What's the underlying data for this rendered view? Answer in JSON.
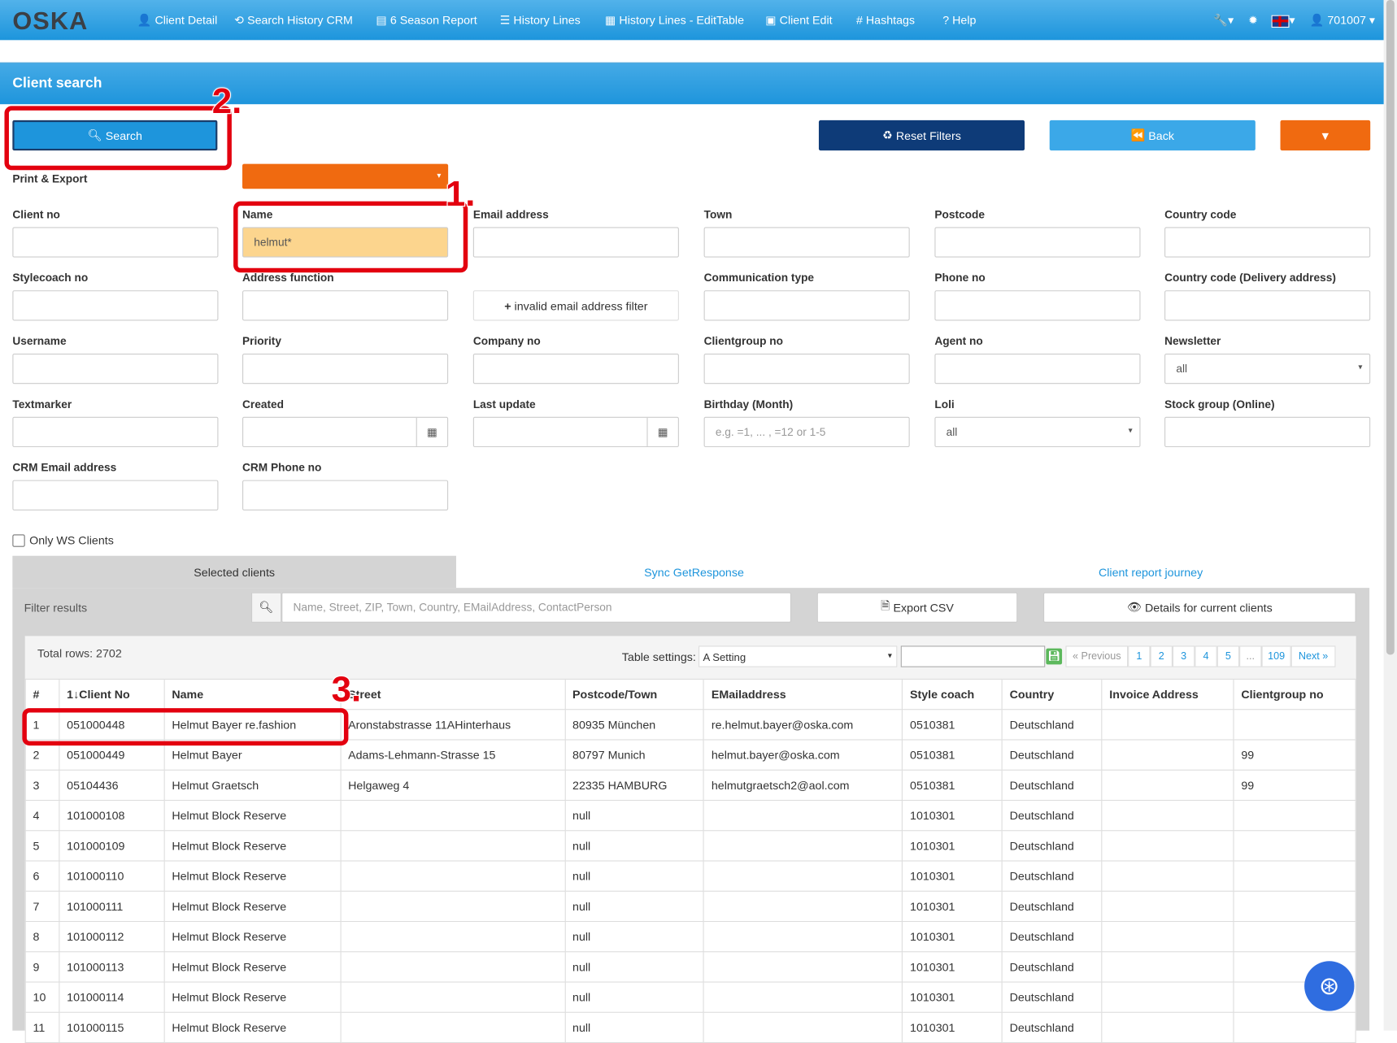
{
  "nav": {
    "logo": "OSKA",
    "items": [
      {
        "icon": "user-icon",
        "glyph": "👤",
        "label": "Client Detail"
      },
      {
        "icon": "history-icon",
        "glyph": "⟲",
        "label": "Search History CRM"
      },
      {
        "icon": "list-alt-icon",
        "glyph": "▤",
        "label": "6 Season Report"
      },
      {
        "icon": "list-icon",
        "glyph": "☰",
        "label": "History Lines"
      },
      {
        "icon": "table-icon",
        "glyph": "▦",
        "label": "History Lines - EditTable"
      },
      {
        "icon": "contact-icon",
        "glyph": "▣",
        "label": "Client Edit"
      },
      {
        "icon": "hashtag-icon",
        "glyph": "#",
        "label": "Hashtags"
      },
      {
        "icon": "question-icon",
        "glyph": "?",
        "label": "Help"
      }
    ],
    "user": "701007"
  },
  "panel": {
    "title": "Client search"
  },
  "buttons": {
    "search": "Search",
    "reset": "Reset Filters",
    "back": "Back"
  },
  "print_export": "Print & Export",
  "fields": [
    {
      "label": "Client no",
      "value": ""
    },
    {
      "label": "Name",
      "value": "helmut*"
    },
    {
      "label": "Email address",
      "value": ""
    },
    {
      "label": "Town",
      "value": ""
    },
    {
      "label": "Postcode",
      "value": ""
    },
    {
      "label": "Country code",
      "value": ""
    },
    {
      "label": "Stylecoach no",
      "value": ""
    },
    {
      "label": "Address function",
      "value": ""
    },
    {
      "label": "",
      "value": ""
    },
    {
      "label": "Communication type",
      "value": ""
    },
    {
      "label": "Phone no",
      "value": ""
    },
    {
      "label": "Country code (Delivery address)",
      "value": ""
    },
    {
      "label": "Username",
      "value": ""
    },
    {
      "label": "Priority",
      "value": ""
    },
    {
      "label": "Company no",
      "value": ""
    },
    {
      "label": "Clientgroup no",
      "value": ""
    },
    {
      "label": "Agent no",
      "value": ""
    },
    {
      "label": "Newsletter",
      "value": "all"
    },
    {
      "label": "Textmarker",
      "value": ""
    },
    {
      "label": "Created",
      "value": ""
    },
    {
      "label": "Last update",
      "value": ""
    },
    {
      "label": "Birthday (Month)",
      "value": "",
      "placeholder": "e.g. =1, ... , =12 or 1-5"
    },
    {
      "label": "Loli",
      "value": "all"
    },
    {
      "label": "Stock group (Online)",
      "value": ""
    },
    {
      "label": "CRM Email address",
      "value": ""
    },
    {
      "label": "CRM Phone no",
      "value": ""
    }
  ],
  "invalid_email_filter": "invalid email address filter",
  "only_ws": "Only WS Clients",
  "tabs": [
    "Selected clients",
    "Sync GetResponse",
    "Client report journey"
  ],
  "filter": {
    "label": "Filter results",
    "placeholder": "Name, Street, ZIP, Town, Country, EMailAddress, ContactPerson",
    "export": "Export CSV",
    "details": "Details for current clients"
  },
  "total_rows": "Total rows: 2702",
  "table_settings": {
    "label": "Table settings:",
    "value": "A Setting"
  },
  "pagination": [
    "« Previous",
    "1",
    "2",
    "3",
    "4",
    "5",
    "...",
    "109",
    "Next »"
  ],
  "annotations": [
    "1.",
    "2.",
    "3."
  ],
  "table": {
    "headers": [
      "#",
      "1↓Client No",
      "Name",
      "Street",
      "Postcode/Town",
      "EMailaddress",
      "Style coach",
      "Country",
      "Invoice Address",
      "Clientgroup no"
    ],
    "rows": [
      [
        "1",
        "051000448",
        "Helmut Bayer re.fashion",
        "Aronstabstrasse 11AHinterhaus",
        "80935 München",
        "re.helmut.bayer@oska.com",
        "0510381",
        "Deutschland",
        "",
        ""
      ],
      [
        "2",
        "051000449",
        "Helmut Bayer",
        "Adams-Lehmann-Strasse 15",
        "80797 Munich",
        "helmut.bayer@oska.com",
        "0510381",
        "Deutschland",
        "",
        "99"
      ],
      [
        "3",
        "05104436",
        "Helmut Graetsch",
        "Helgaweg 4",
        "22335 HAMBURG",
        "helmutgraetsch2@aol.com",
        "0510381",
        "Deutschland",
        "",
        "99"
      ],
      [
        "4",
        "101000108",
        "Helmut Block Reserve",
        "",
        "null",
        "",
        "1010301",
        "Deutschland",
        "",
        ""
      ],
      [
        "5",
        "101000109",
        "Helmut Block Reserve",
        "",
        "null",
        "",
        "1010301",
        "Deutschland",
        "",
        ""
      ],
      [
        "6",
        "101000110",
        "Helmut Block Reserve",
        "",
        "null",
        "",
        "1010301",
        "Deutschland",
        "",
        ""
      ],
      [
        "7",
        "101000111",
        "Helmut Block Reserve",
        "",
        "null",
        "",
        "1010301",
        "Deutschland",
        "",
        ""
      ],
      [
        "8",
        "101000112",
        "Helmut Block Reserve",
        "",
        "null",
        "",
        "1010301",
        "Deutschland",
        "",
        ""
      ],
      [
        "9",
        "101000113",
        "Helmut Block Reserve",
        "",
        "null",
        "",
        "1010301",
        "Deutschland",
        "",
        ""
      ],
      [
        "10",
        "101000114",
        "Helmut Block Reserve",
        "",
        "null",
        "",
        "1010301",
        "Deutschland",
        "",
        ""
      ],
      [
        "11",
        "101000115",
        "Helmut Block Reserve",
        "",
        "null",
        "",
        "1010301",
        "Deutschland",
        "",
        ""
      ]
    ]
  }
}
